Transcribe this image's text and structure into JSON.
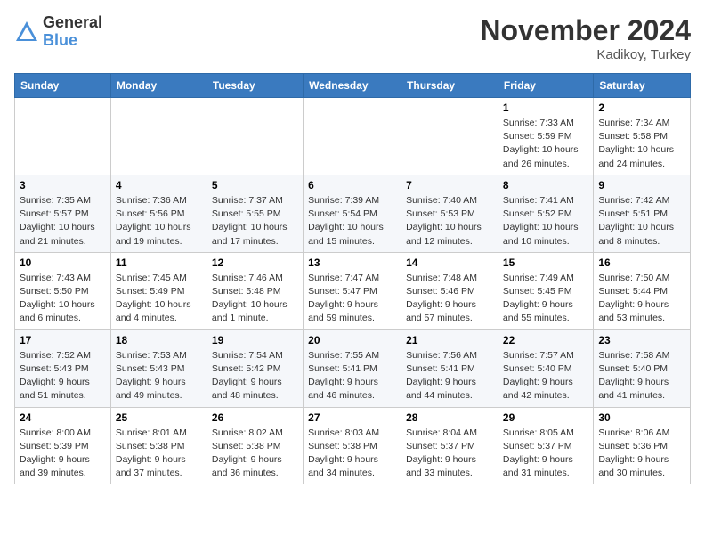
{
  "header": {
    "logo_general": "General",
    "logo_blue": "Blue",
    "month_title": "November 2024",
    "location": "Kadikoy, Turkey"
  },
  "weekdays": [
    "Sunday",
    "Monday",
    "Tuesday",
    "Wednesday",
    "Thursday",
    "Friday",
    "Saturday"
  ],
  "weeks": [
    [
      {
        "day": "",
        "info": ""
      },
      {
        "day": "",
        "info": ""
      },
      {
        "day": "",
        "info": ""
      },
      {
        "day": "",
        "info": ""
      },
      {
        "day": "",
        "info": ""
      },
      {
        "day": "1",
        "info": "Sunrise: 7:33 AM\nSunset: 5:59 PM\nDaylight: 10 hours and 26 minutes."
      },
      {
        "day": "2",
        "info": "Sunrise: 7:34 AM\nSunset: 5:58 PM\nDaylight: 10 hours and 24 minutes."
      }
    ],
    [
      {
        "day": "3",
        "info": "Sunrise: 7:35 AM\nSunset: 5:57 PM\nDaylight: 10 hours and 21 minutes."
      },
      {
        "day": "4",
        "info": "Sunrise: 7:36 AM\nSunset: 5:56 PM\nDaylight: 10 hours and 19 minutes."
      },
      {
        "day": "5",
        "info": "Sunrise: 7:37 AM\nSunset: 5:55 PM\nDaylight: 10 hours and 17 minutes."
      },
      {
        "day": "6",
        "info": "Sunrise: 7:39 AM\nSunset: 5:54 PM\nDaylight: 10 hours and 15 minutes."
      },
      {
        "day": "7",
        "info": "Sunrise: 7:40 AM\nSunset: 5:53 PM\nDaylight: 10 hours and 12 minutes."
      },
      {
        "day": "8",
        "info": "Sunrise: 7:41 AM\nSunset: 5:52 PM\nDaylight: 10 hours and 10 minutes."
      },
      {
        "day": "9",
        "info": "Sunrise: 7:42 AM\nSunset: 5:51 PM\nDaylight: 10 hours and 8 minutes."
      }
    ],
    [
      {
        "day": "10",
        "info": "Sunrise: 7:43 AM\nSunset: 5:50 PM\nDaylight: 10 hours and 6 minutes."
      },
      {
        "day": "11",
        "info": "Sunrise: 7:45 AM\nSunset: 5:49 PM\nDaylight: 10 hours and 4 minutes."
      },
      {
        "day": "12",
        "info": "Sunrise: 7:46 AM\nSunset: 5:48 PM\nDaylight: 10 hours and 1 minute."
      },
      {
        "day": "13",
        "info": "Sunrise: 7:47 AM\nSunset: 5:47 PM\nDaylight: 9 hours and 59 minutes."
      },
      {
        "day": "14",
        "info": "Sunrise: 7:48 AM\nSunset: 5:46 PM\nDaylight: 9 hours and 57 minutes."
      },
      {
        "day": "15",
        "info": "Sunrise: 7:49 AM\nSunset: 5:45 PM\nDaylight: 9 hours and 55 minutes."
      },
      {
        "day": "16",
        "info": "Sunrise: 7:50 AM\nSunset: 5:44 PM\nDaylight: 9 hours and 53 minutes."
      }
    ],
    [
      {
        "day": "17",
        "info": "Sunrise: 7:52 AM\nSunset: 5:43 PM\nDaylight: 9 hours and 51 minutes."
      },
      {
        "day": "18",
        "info": "Sunrise: 7:53 AM\nSunset: 5:43 PM\nDaylight: 9 hours and 49 minutes."
      },
      {
        "day": "19",
        "info": "Sunrise: 7:54 AM\nSunset: 5:42 PM\nDaylight: 9 hours and 48 minutes."
      },
      {
        "day": "20",
        "info": "Sunrise: 7:55 AM\nSunset: 5:41 PM\nDaylight: 9 hours and 46 minutes."
      },
      {
        "day": "21",
        "info": "Sunrise: 7:56 AM\nSunset: 5:41 PM\nDaylight: 9 hours and 44 minutes."
      },
      {
        "day": "22",
        "info": "Sunrise: 7:57 AM\nSunset: 5:40 PM\nDaylight: 9 hours and 42 minutes."
      },
      {
        "day": "23",
        "info": "Sunrise: 7:58 AM\nSunset: 5:40 PM\nDaylight: 9 hours and 41 minutes."
      }
    ],
    [
      {
        "day": "24",
        "info": "Sunrise: 8:00 AM\nSunset: 5:39 PM\nDaylight: 9 hours and 39 minutes."
      },
      {
        "day": "25",
        "info": "Sunrise: 8:01 AM\nSunset: 5:38 PM\nDaylight: 9 hours and 37 minutes."
      },
      {
        "day": "26",
        "info": "Sunrise: 8:02 AM\nSunset: 5:38 PM\nDaylight: 9 hours and 36 minutes."
      },
      {
        "day": "27",
        "info": "Sunrise: 8:03 AM\nSunset: 5:38 PM\nDaylight: 9 hours and 34 minutes."
      },
      {
        "day": "28",
        "info": "Sunrise: 8:04 AM\nSunset: 5:37 PM\nDaylight: 9 hours and 33 minutes."
      },
      {
        "day": "29",
        "info": "Sunrise: 8:05 AM\nSunset: 5:37 PM\nDaylight: 9 hours and 31 minutes."
      },
      {
        "day": "30",
        "info": "Sunrise: 8:06 AM\nSunset: 5:36 PM\nDaylight: 9 hours and 30 minutes."
      }
    ]
  ]
}
